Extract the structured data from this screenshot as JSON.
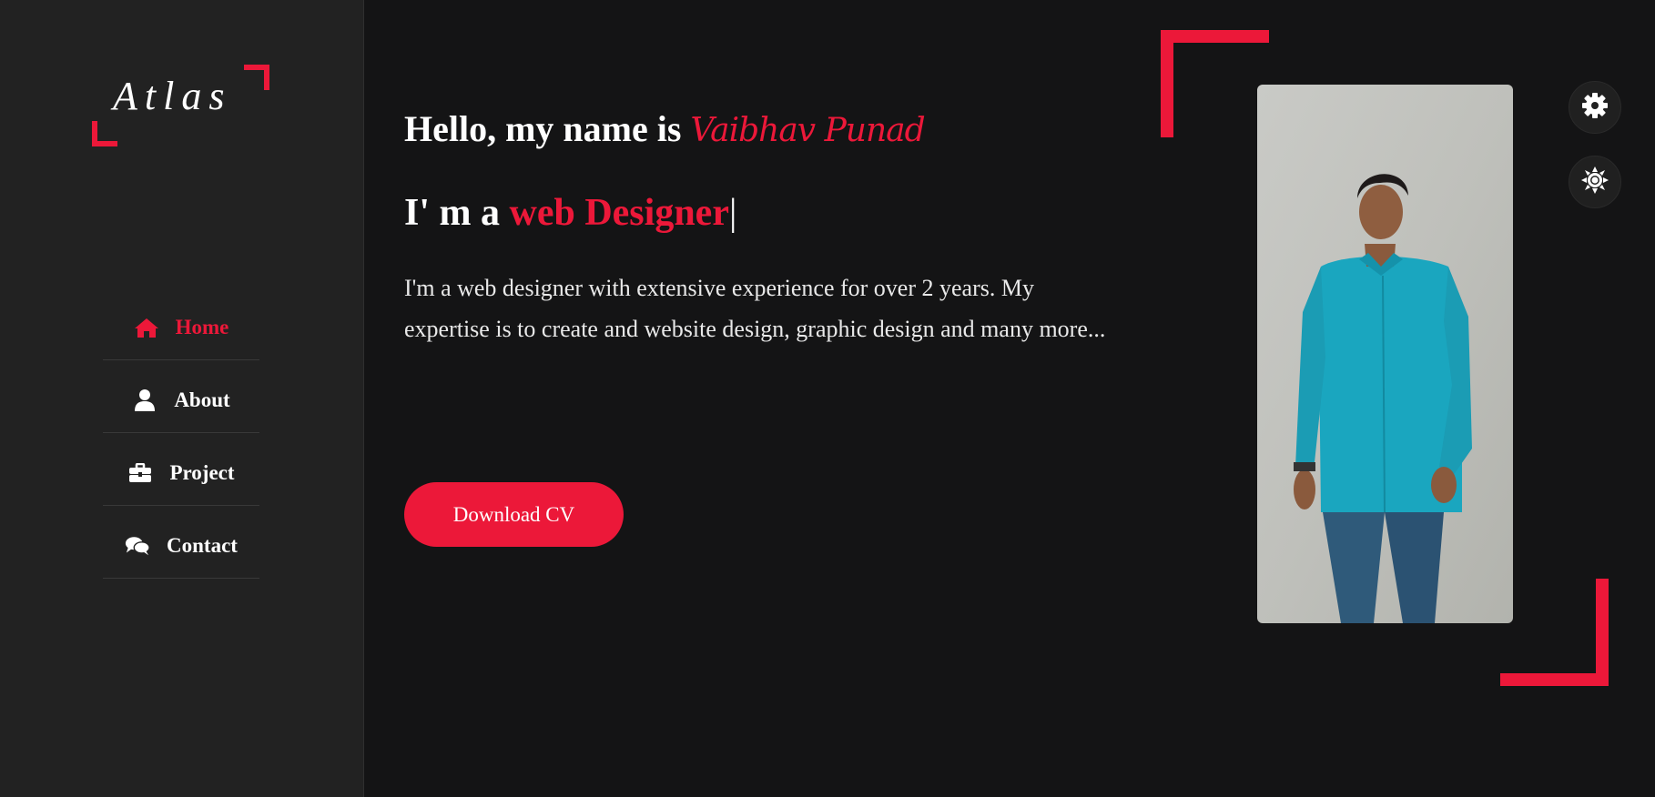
{
  "logo": {
    "text": "Atlas"
  },
  "nav": [
    {
      "label": "Home",
      "icon": "home-icon",
      "active": true
    },
    {
      "label": "About",
      "icon": "user-icon",
      "active": false
    },
    {
      "label": "Project",
      "icon": "briefcase-icon",
      "active": false
    },
    {
      "label": "Contact",
      "icon": "chat-icon",
      "active": false
    }
  ],
  "hero": {
    "greeting": "Hello, my name is ",
    "name": "Vaibhav Punad",
    "role_prefix": "I' m a ",
    "role": "web Designer",
    "cursor": "|",
    "description": "I'm a web designer with extensive experience for over 2 years. My expertise is to create and website design, graphic design and many more...",
    "button_label": "Download CV"
  },
  "controls": {
    "settings_icon": "gear-icon",
    "theme_icon": "sun-icon"
  },
  "colors": {
    "accent": "#ec1839",
    "background": "#141415",
    "sidebar": "#222222",
    "text": "#ffffff"
  }
}
